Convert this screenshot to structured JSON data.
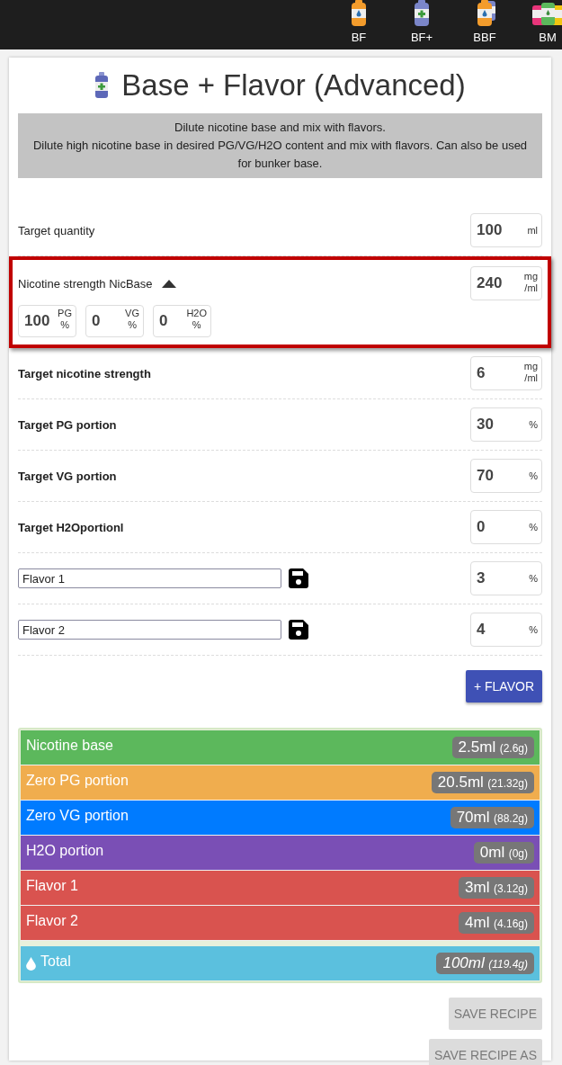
{
  "nav": [
    {
      "label": "BF",
      "kind": "single"
    },
    {
      "label": "BF+",
      "kind": "plus"
    },
    {
      "label": "BBF",
      "kind": "double"
    },
    {
      "label": "BM",
      "kind": "multi"
    }
  ],
  "title": "Base + Flavor (Advanced)",
  "description": [
    "Dilute nicotine base and mix with flavors.",
    "Dilute high nicotine base in desired PG/VG/H2O content and mix with flavors. Can also be used for bunker base."
  ],
  "fields": [
    {
      "kind": "number",
      "label": "Target quantity",
      "bold": false,
      "value": "100",
      "unit": [
        "ml"
      ]
    },
    {
      "kind": "base",
      "label": "Nicotine strength NicBase",
      "bold": false,
      "highlighted": true,
      "expanded": true,
      "value": "240",
      "unit": [
        "mg",
        "/ml"
      ],
      "parts": [
        {
          "value": "100",
          "unit": [
            "PG",
            "%"
          ]
        },
        {
          "value": "0",
          "unit": [
            "VG",
            "%"
          ]
        },
        {
          "value": "0",
          "unit": [
            "H2O",
            "%"
          ]
        }
      ]
    },
    {
      "kind": "number",
      "label": "Target nicotine strength",
      "bold": true,
      "value": "6",
      "unit": [
        "mg",
        "/ml"
      ]
    },
    {
      "kind": "number",
      "label": "Target PG portion",
      "bold": true,
      "value": "30",
      "unit": [
        "%"
      ]
    },
    {
      "kind": "number",
      "label": "Target VG portion",
      "bold": true,
      "value": "70",
      "unit": [
        "%"
      ]
    },
    {
      "kind": "number",
      "label": "Target H2Oportionl",
      "bold": true,
      "value": "0",
      "unit": [
        "%"
      ]
    },
    {
      "kind": "flavor",
      "name": "Flavor 1",
      "value": "3",
      "unit": [
        "%"
      ]
    },
    {
      "kind": "flavor",
      "name": "Flavor 2",
      "value": "4",
      "unit": [
        "%"
      ]
    }
  ],
  "add_button": "+ FLAVOR",
  "results": [
    {
      "label": "Nicotine base",
      "amount": "2.5ml",
      "weight": "(2.6g)",
      "color": "#5cb85c"
    },
    {
      "label": "Zero PG portion",
      "amount": "20.5ml",
      "weight": "(21.32g)",
      "color": "#f0ad4e"
    },
    {
      "label": "Zero VG portion",
      "amount": "70ml",
      "weight": "(88.2g)",
      "color": "#007bff"
    },
    {
      "label": "H2O portion",
      "amount": "0ml",
      "weight": "(0g)",
      "color": "#7a4fb5"
    },
    {
      "label": "Flavor 1",
      "amount": "3ml",
      "weight": "(3.12g)",
      "color": "#d9534f"
    },
    {
      "label": "Flavor 2",
      "amount": "4ml",
      "weight": "(4.16g)",
      "color": "#d9534f"
    }
  ],
  "total": {
    "label": "Total",
    "amount": "100ml",
    "weight": "(119.4g)",
    "color": "#5bc0de"
  },
  "buttons": [
    {
      "label": "SAVE RECIPE",
      "disabled": true
    },
    {
      "label": "SAVE RECIPE AS",
      "disabled": true
    }
  ]
}
